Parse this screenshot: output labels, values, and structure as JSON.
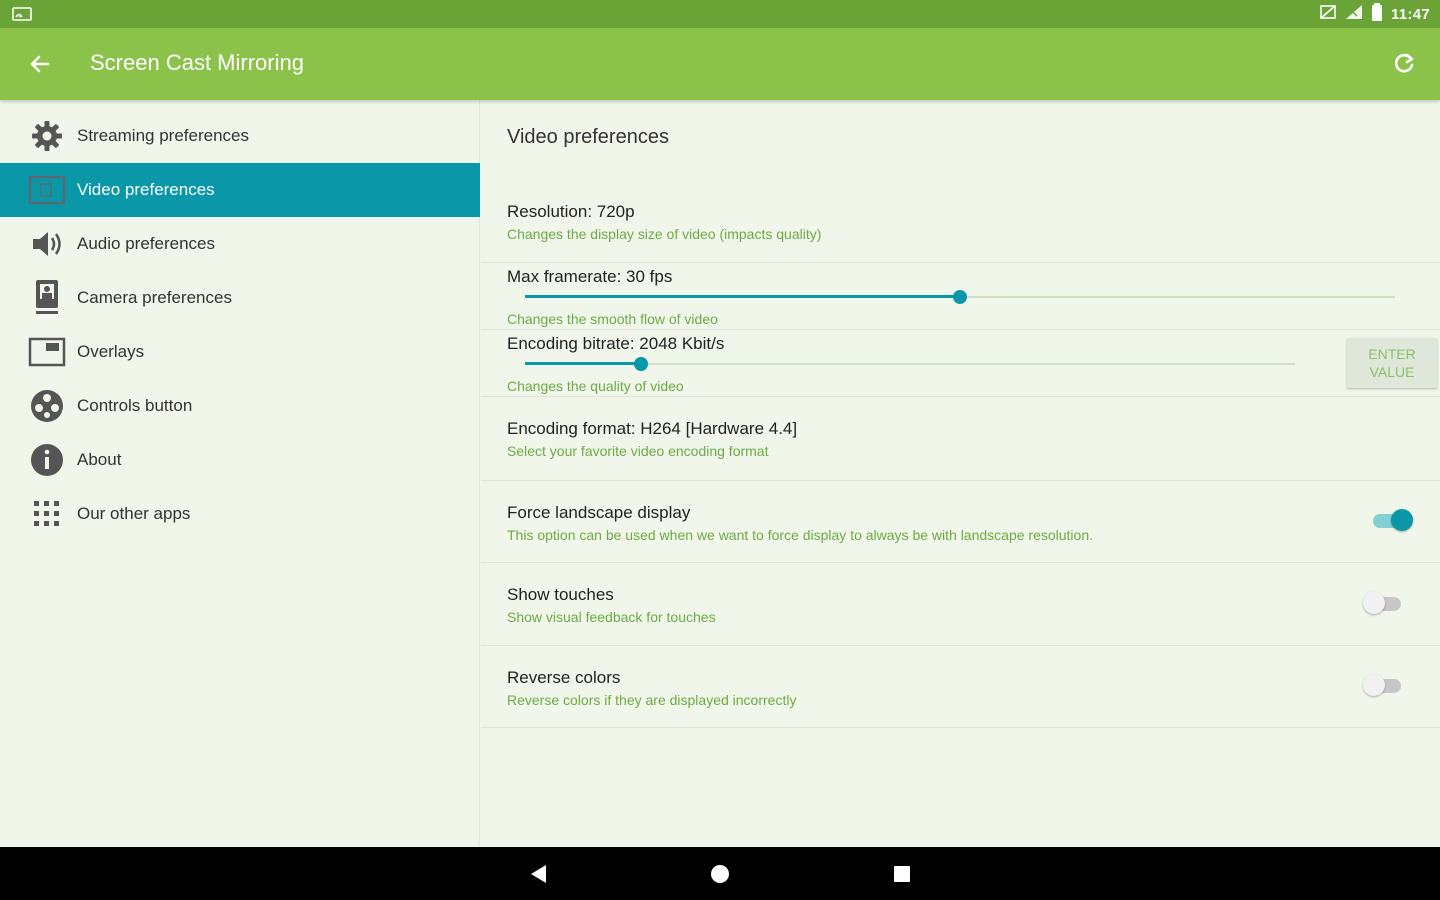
{
  "status_bar": {
    "time": "11:47",
    "icons": [
      "cast-icon",
      "no-sim-icon",
      "signal-icon",
      "battery-icon"
    ]
  },
  "app_bar": {
    "title": "Screen Cast Mirroring",
    "back_icon": "arrow-back-icon",
    "refresh_icon": "refresh-icon"
  },
  "sidebar": {
    "items": [
      {
        "label": "Streaming preferences",
        "icon": "gear-icon"
      },
      {
        "label": "Video preferences",
        "icon": "video-icon",
        "active": true
      },
      {
        "label": "Audio preferences",
        "icon": "speaker-icon"
      },
      {
        "label": "Camera preferences",
        "icon": "camera-icon"
      },
      {
        "label": "Overlays",
        "icon": "overlay-icon"
      },
      {
        "label": "Controls button",
        "icon": "controls-icon"
      },
      {
        "label": "About",
        "icon": "info-icon"
      },
      {
        "label": "Our other apps",
        "icon": "apps-grid-icon"
      }
    ]
  },
  "content": {
    "section_title": "Video preferences",
    "resolution": {
      "title": "Resolution: 720p",
      "subtitle": "Changes the display size of video (impacts quality)"
    },
    "framerate": {
      "title": "Max framerate: 30 fps",
      "subtitle": "Changes the smooth flow of video",
      "level": 0.5
    },
    "bitrate": {
      "title": "Encoding bitrate: 2048 Kbit/s",
      "subtitle": "Changes the quality of video",
      "level": 0.15,
      "button_label": "ENTER VALUE"
    },
    "format": {
      "title": "Encoding format: H264 [Hardware 4.4]",
      "subtitle": "Select your favorite video encoding format"
    },
    "landscape": {
      "title": "Force landscape display",
      "subtitle": "This option can be used when we want to force display to always be with landscape resolution.",
      "enabled": true
    },
    "touches": {
      "title": "Show touches",
      "subtitle": "Show visual feedback for touches",
      "enabled": false
    },
    "reverse": {
      "title": "Reverse colors",
      "subtitle": "Reverse colors if they are displayed incorrectly",
      "enabled": false
    }
  },
  "colors": {
    "status_bar": "#6aa336",
    "app_bar": "#8bc34a",
    "accent": "#0a97a8",
    "subtitle": "#6cab45",
    "background": "#f0f6ea"
  },
  "nav_bar": {
    "icons": [
      "back-triangle-icon",
      "home-circle-icon",
      "recents-square-icon"
    ]
  }
}
